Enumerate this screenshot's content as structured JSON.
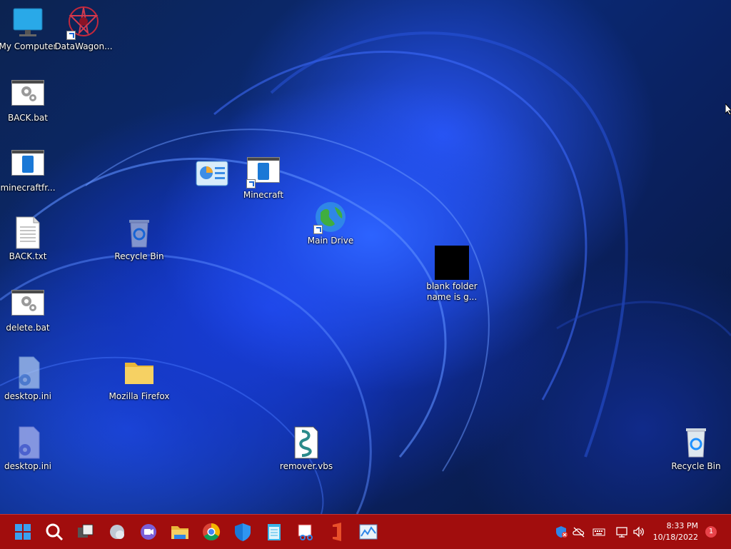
{
  "desktop": {
    "icons": [
      {
        "label": "My Computer",
        "icon": "monitor-icon"
      },
      {
        "label": "DataWagon...",
        "icon": "datawagon-icon"
      },
      {
        "label": "BACK.bat",
        "icon": "batch-file-icon"
      },
      {
        "label": "minecraftfr...",
        "icon": "app-window-icon"
      },
      {
        "label": "BACK.txt",
        "icon": "text-file-icon"
      },
      {
        "label": "Recycle Bin",
        "icon": "recycle-bin-icon"
      },
      {
        "label": "delete.bat",
        "icon": "batch-file-icon"
      },
      {
        "label": "desktop.ini",
        "icon": "settings-file-icon"
      },
      {
        "label": "Mozilla Firefox",
        "icon": "folder-icon"
      },
      {
        "label": "desktop.ini",
        "icon": "settings-file-icon"
      },
      {
        "label": "Minecraft",
        "icon": "app-window-icon"
      },
      {
        "label": "Main Drive",
        "icon": "globe-icon"
      },
      {
        "label": "blank folder name is g...",
        "icon": "black-square-icon"
      },
      {
        "label": "remover.vbs",
        "icon": "script-file-icon"
      },
      {
        "label": "Recycle Bin",
        "icon": "recycle-bin-icon"
      }
    ]
  },
  "taskbar": {
    "apps": [
      "start-icon",
      "search-icon",
      "task-view-icon",
      "widgets-icon",
      "chat-icon",
      "file-explorer-icon",
      "chrome-icon",
      "defender-icon",
      "notepad-icon",
      "snipping-tool-icon",
      "office-icon",
      "resource-monitor-icon"
    ],
    "tray": [
      "security-icon",
      "onedrive-icon",
      "keyboard-icon",
      "network-icon",
      "volume-icon"
    ],
    "clock": {
      "time": "8:33 PM",
      "date": "10/18/2022"
    },
    "notification_count": "1",
    "colors": {
      "taskbar": "#a10d0d",
      "accent": "#2d63ff"
    }
  }
}
